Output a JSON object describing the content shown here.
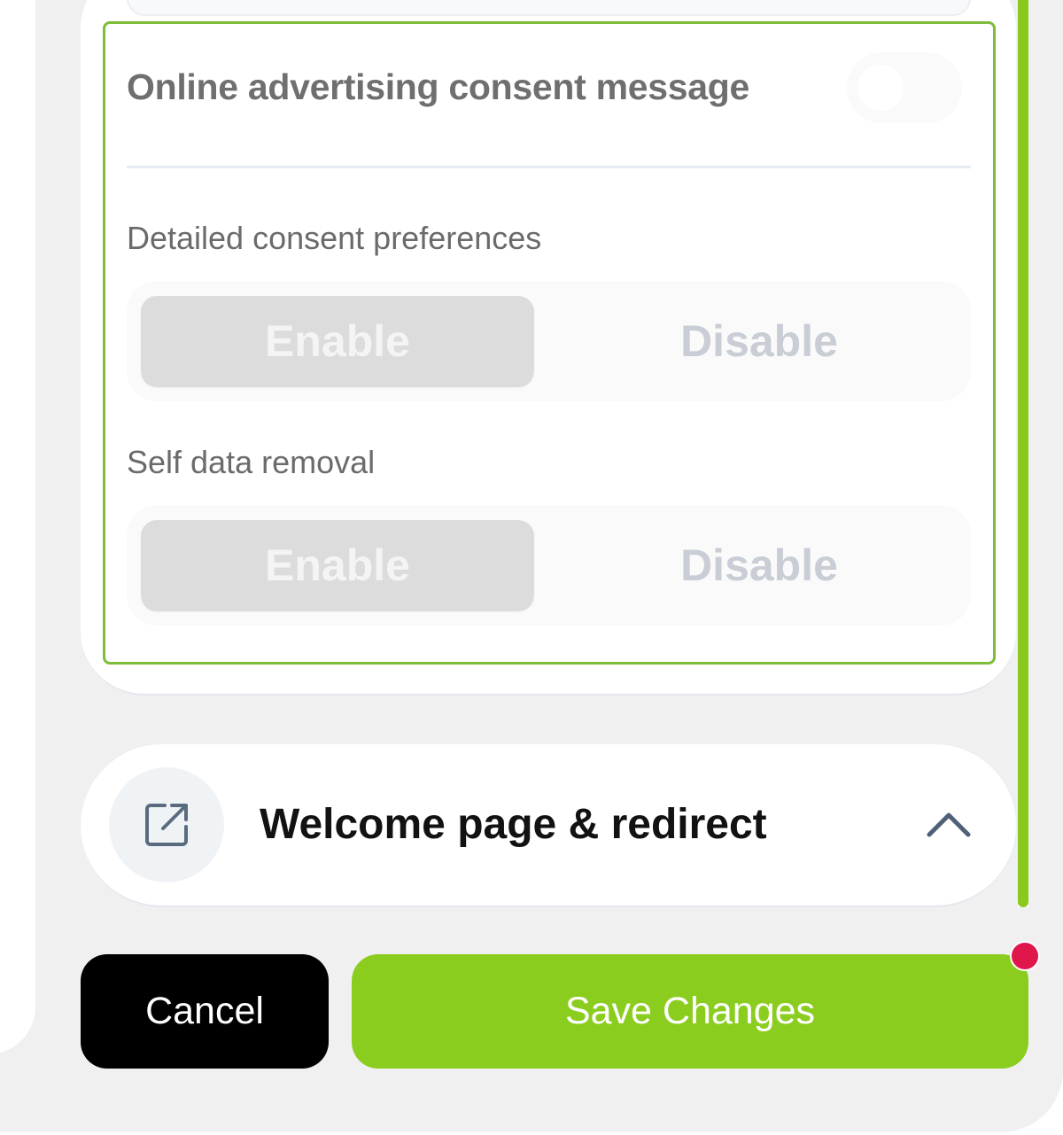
{
  "consent": {
    "title": "Online advertising consent message",
    "toggle_enabled": false,
    "sections": [
      {
        "label": "Detailed consent preferences",
        "enable_label": "Enable",
        "disable_label": "Disable",
        "selected": "Enable"
      },
      {
        "label": "Self data removal",
        "enable_label": "Enable",
        "disable_label": "Disable",
        "selected": "Enable"
      }
    ]
  },
  "welcome": {
    "title": "Welcome page & redirect",
    "icon": "external-link-icon",
    "expand_icon": "chevron-up-icon"
  },
  "actions": {
    "cancel_label": "Cancel",
    "save_label": "Save Changes",
    "has_unsaved_changes": true
  },
  "colors": {
    "accent": "#8bcd1f",
    "highlight_border": "#7cbd3a",
    "notification": "#e0174d",
    "cancel_bg": "#000000"
  }
}
